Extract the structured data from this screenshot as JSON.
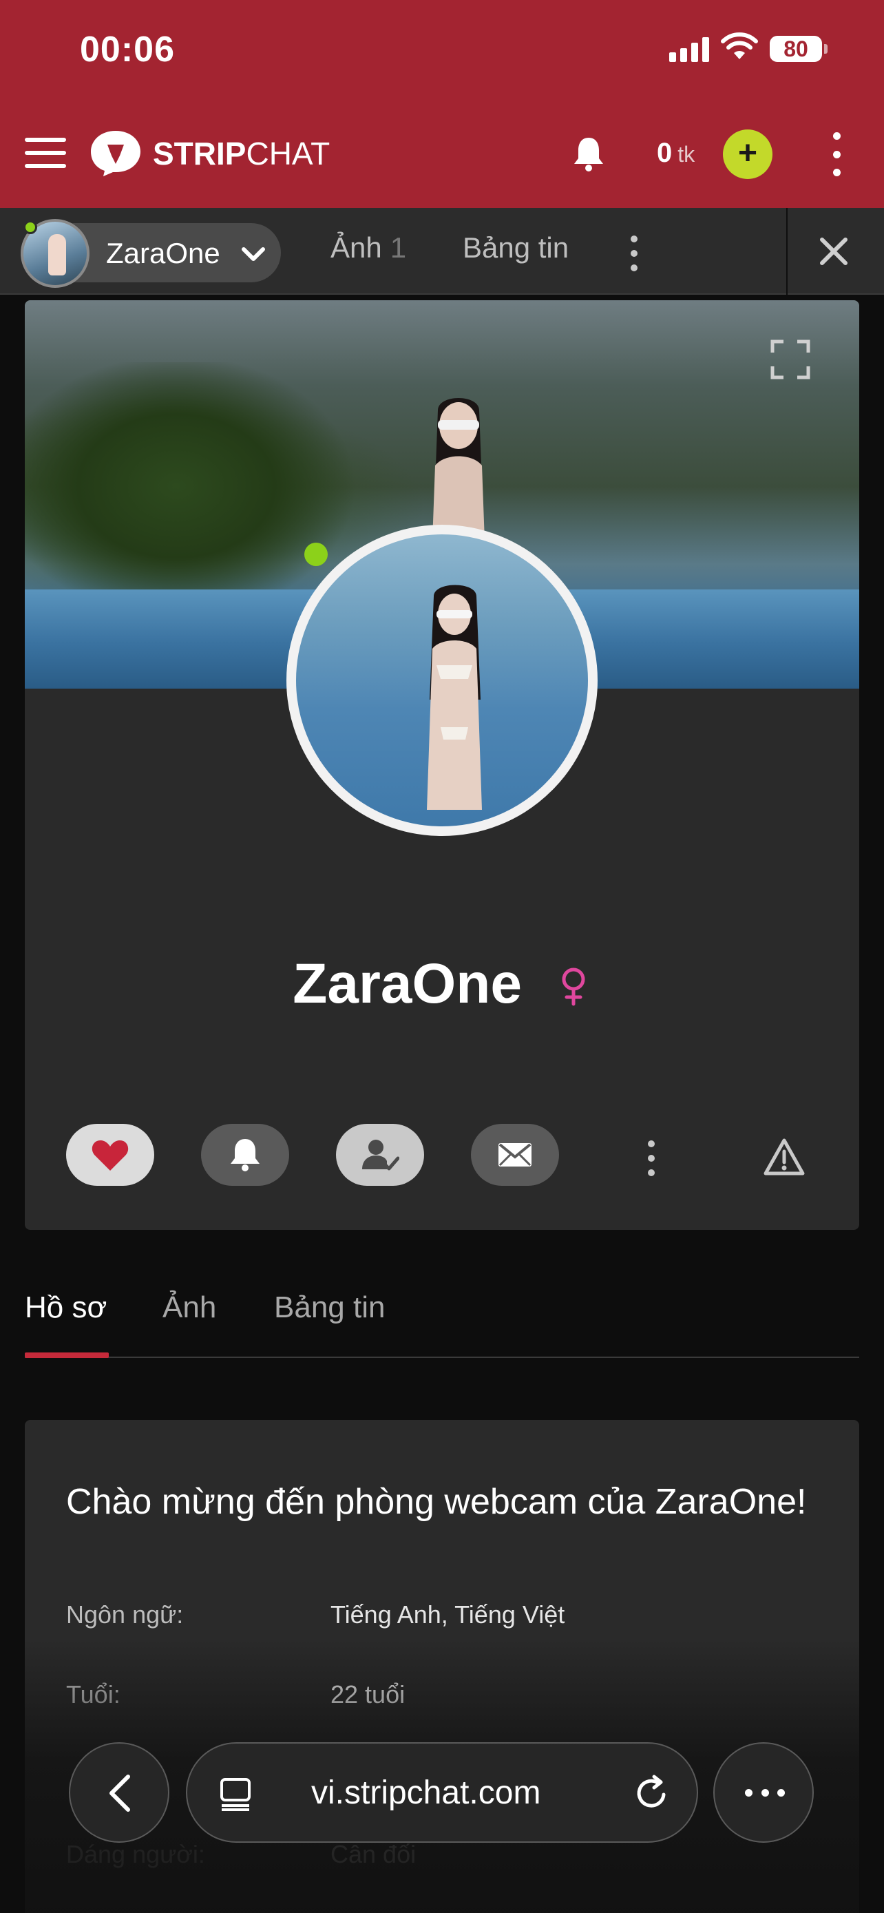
{
  "status": {
    "time": "00:06",
    "battery": "80"
  },
  "header": {
    "brand_bold": "STRIP",
    "brand_rest": "CHAT",
    "tokens_value": "0",
    "tokens_unit": "tk",
    "add_label": "+"
  },
  "model_bar": {
    "name": "ZaraOne",
    "tab_photos": "Ảnh",
    "tab_photos_count": "1",
    "tab_feed": "Bảng tin"
  },
  "profile": {
    "name": "ZaraOne",
    "gender_icon": "female-symbol",
    "online": true
  },
  "tabs": [
    {
      "label": "Hồ sơ",
      "active": true
    },
    {
      "label": "Ảnh",
      "active": false
    },
    {
      "label": "Bảng tin",
      "active": false
    }
  ],
  "info": {
    "title": "Chào mừng đến phòng webcam của ZaraOne!",
    "rows": [
      {
        "key": "Ngôn ngữ:",
        "value": "Tiếng Anh, Tiếng Việt"
      },
      {
        "key": "Tuổi:",
        "value": "22 tuổi"
      },
      {
        "key": "",
        "value": ""
      },
      {
        "key": "Dáng người:",
        "value": "Cân đối"
      }
    ]
  },
  "browser": {
    "url": "vi.stripchat.com"
  },
  "colors": {
    "header_red": "#a32431",
    "accent_green": "#c3d92a",
    "online_green": "#8cd11a",
    "tab_underline": "#c52a3a",
    "gender_pink": "#e0479e"
  }
}
